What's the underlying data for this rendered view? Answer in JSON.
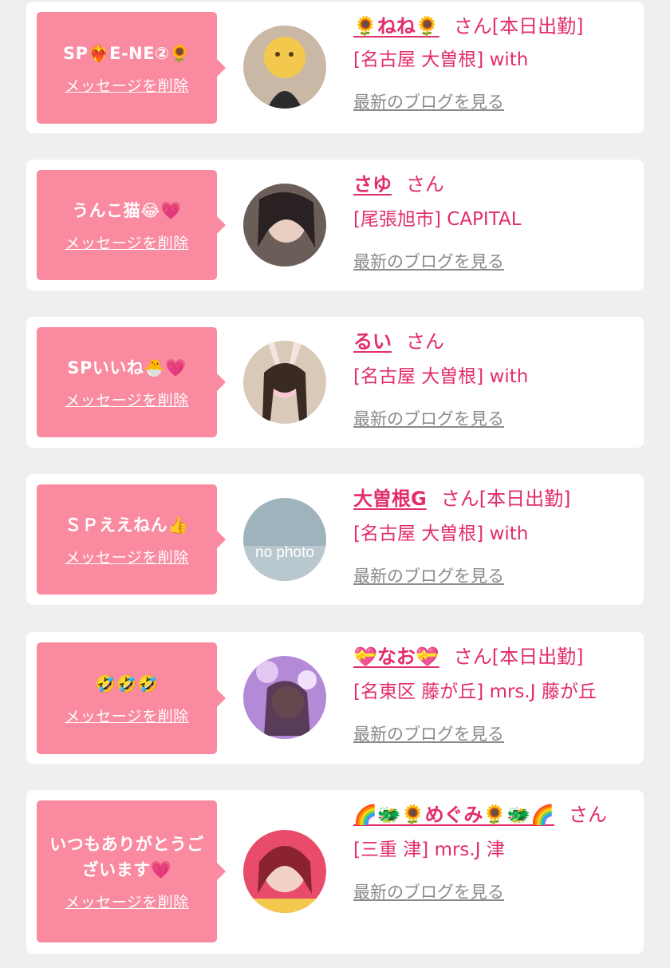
{
  "items": [
    {
      "message": "SP❤️‍🔥E-NE②🌻",
      "delete_label": "メッセージを削除",
      "name": "🌻ねね🌻",
      "honorific": "さん",
      "status": "[本日出勤]",
      "shop": "[名古屋 大曽根] with",
      "blog_label": "最新のブログを見る",
      "avatar": "profile-photo"
    },
    {
      "message": "うんこ猫😂💗",
      "delete_label": "メッセージを削除",
      "name": "さゆ",
      "honorific": "さん",
      "status": "",
      "shop": "[尾張旭市] CAPITAL",
      "blog_label": "最新のブログを見る",
      "avatar": "profile-photo"
    },
    {
      "message": "SPいいね🐣💗",
      "delete_label": "メッセージを削除",
      "name": "るい",
      "honorific": "さん",
      "status": "",
      "shop": "[名古屋 大曽根] with",
      "blog_label": "最新のブログを見る",
      "avatar": "profile-photo"
    },
    {
      "message": "ＳＰええねん👍",
      "delete_label": "メッセージを削除",
      "name": "大曽根G",
      "honorific": "さん",
      "status": "[本日出勤]",
      "shop": "[名古屋 大曽根] with",
      "blog_label": "最新のブログを見る",
      "avatar": "no photo"
    },
    {
      "message": "🤣🤣🤣",
      "delete_label": "メッセージを削除",
      "name": "💝なお💝",
      "honorific": "さん",
      "status": "[本日出勤]",
      "shop": "[名東区 藤が丘] mrs.J 藤が丘",
      "blog_label": "最新のブログを見る",
      "avatar": "profile-photo"
    },
    {
      "message": "いつもありがとうございます💗",
      "delete_label": "メッセージを削除",
      "name": "🌈🐲🌻めぐみ🌻🐲🌈",
      "honorific": "さん",
      "status": "",
      "shop": "[三重 津] mrs.J 津",
      "blog_label": "最新のブログを見る",
      "avatar": "profile-photo"
    }
  ],
  "colors": {
    "bubble": "#f98aa0",
    "accent": "#e22d6a",
    "muted": "#8a8a8a",
    "background": "#efefef"
  }
}
